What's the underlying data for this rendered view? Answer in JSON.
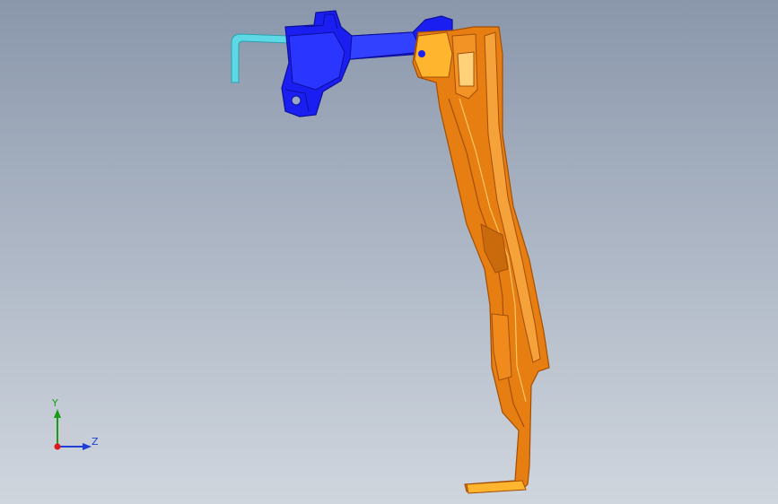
{
  "viewport": {
    "background_top": "#8a97ab",
    "background_bottom": "#d0d6de"
  },
  "model": {
    "bracket_color": "#e67e12",
    "bracket_highlight": "#ffb52e",
    "bracket_shadow": "#a34e06",
    "mount_color": "#1a1ef0",
    "mount_shadow": "#0c0f9a",
    "rod_color": "#5fd8e6"
  },
  "triad": {
    "y_label": "Y",
    "z_label": "Z",
    "y_color": "#1a9c1a",
    "z_color": "#1f3fd6",
    "x_color": "#e01818"
  }
}
